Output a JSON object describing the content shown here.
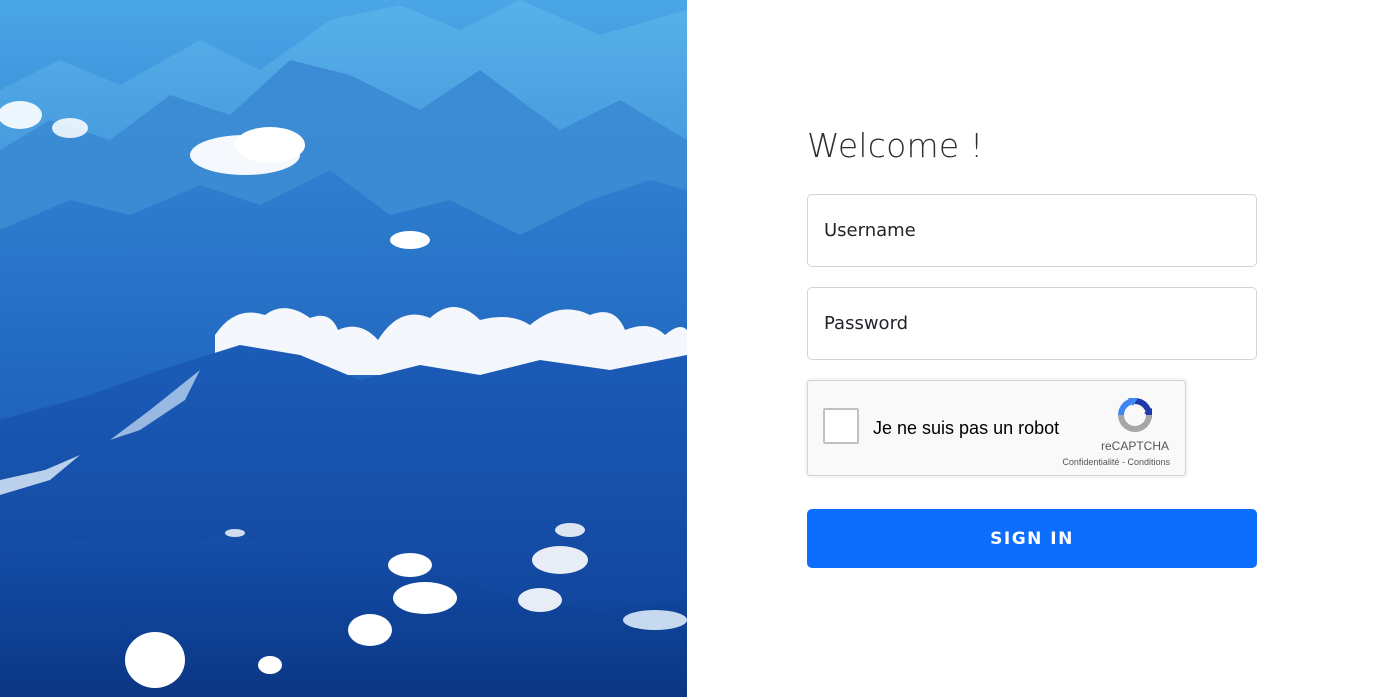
{
  "login": {
    "welcome_title": "Welcome !",
    "username_placeholder": "Username",
    "username_value": "",
    "password_placeholder": "Password",
    "password_value": "",
    "sign_in_label": "SIGN IN"
  },
  "captcha": {
    "label": "Je ne suis pas un robot",
    "checked": false,
    "brand": "reCAPTCHA",
    "privacy_link": "Confidentialité",
    "separator": "-",
    "terms_link": "Conditions",
    "icon": "recaptcha-logo-icon"
  },
  "hero": {
    "image": "mountain-landscape-image"
  },
  "colors": {
    "primary": "#0d6efd",
    "border": "#ced4da",
    "hero_sky": "#4aa6e6",
    "hero_deep": "#123f93"
  }
}
